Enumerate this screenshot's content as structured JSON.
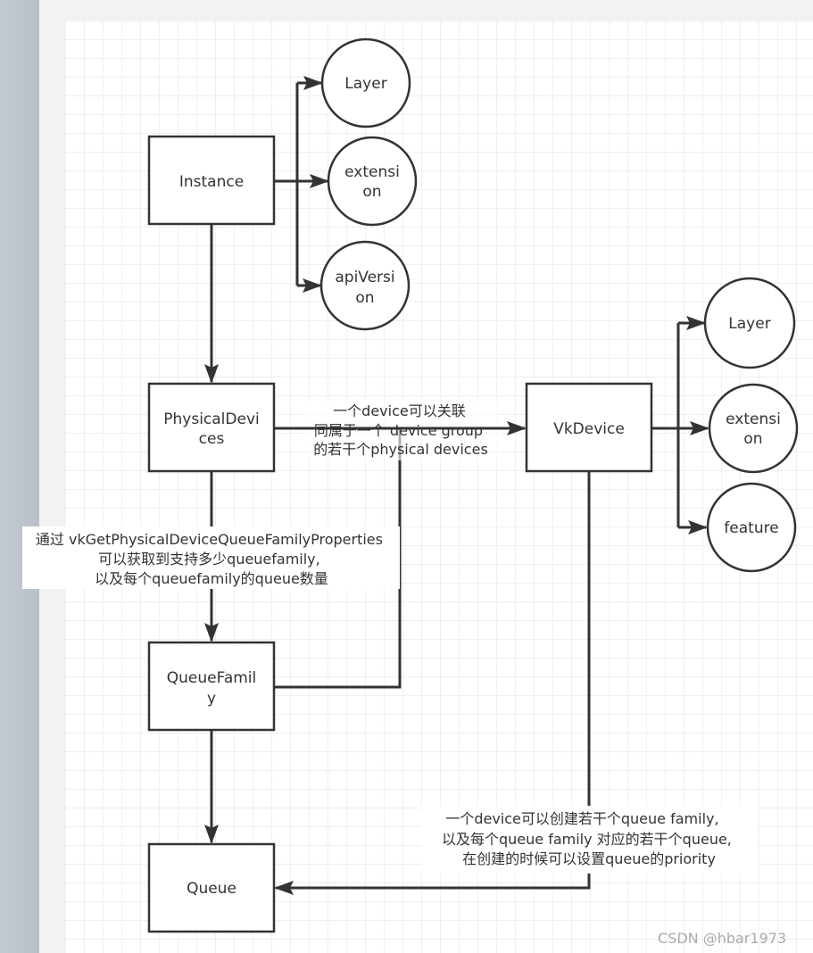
{
  "colors": {
    "stroke": "#333333",
    "canvas": "#ffffff",
    "grid": "#e6e6e6",
    "sidebar": "#c0c6ce",
    "margin": "#f2f2f2"
  },
  "nodes": {
    "instance": "Instance",
    "instance_layer": "Layer",
    "instance_extension": [
      "extensi",
      "on"
    ],
    "instance_apiversion": [
      "apiVersi",
      "on"
    ],
    "physical_devices": [
      "PhysicalDevi",
      "ces"
    ],
    "vkdevice": "VkDevice",
    "device_layer": "Layer",
    "device_extension": [
      "extensi",
      "on"
    ],
    "device_feature": "feature",
    "queue_family": [
      "QueueFamil",
      "y"
    ],
    "queue": "Queue"
  },
  "notes": {
    "device_group": [
      "一个device可以关联",
      "同属于一个 device group",
      "的若干个physical devices"
    ],
    "queue_family_props": [
      "通过 vkGetPhysicalDeviceQueueFamilyProperties",
      "可以获取到支持多少queuefamily,",
      "以及每个queuefamily的queue数量"
    ],
    "create_queue": [
      "一个device可以创建若干个queue family,",
      "以及每个queue family 对应的若干个queue,",
      "在创建的时候可以设置queue的priority"
    ]
  },
  "watermark": "CSDN @hbar1973"
}
